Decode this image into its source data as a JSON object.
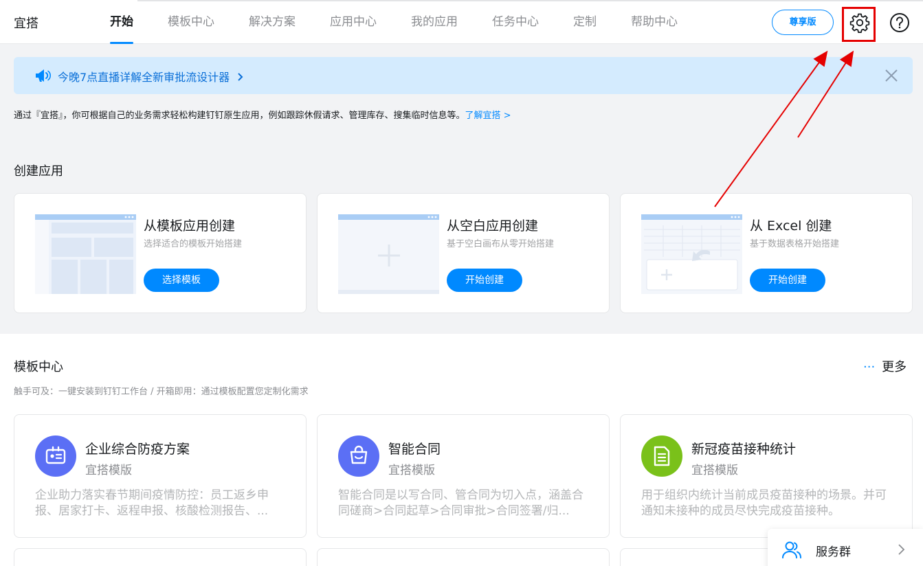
{
  "header": {
    "brand": "宜搭",
    "nav": [
      "开始",
      "模板中心",
      "解决方案",
      "应用中心",
      "我的应用",
      "任务中心",
      "定制",
      "帮助中心"
    ],
    "vip_label": "尊享版"
  },
  "banner": {
    "text": "今晚7点直播详解全新审批流设计器"
  },
  "intro": {
    "text": "通过『宜搭』，你可根据自己的业务需求轻松构建钉钉原生应用，例如跟踪休假请求、管理库存、搜集临时信息等。",
    "link": "了解宜搭 >"
  },
  "create": {
    "title": "创建应用",
    "cards": [
      {
        "title": "从模板应用创建",
        "subtitle": "选择适合的模板开始搭建",
        "button": "选择模板"
      },
      {
        "title": "从空白应用创建",
        "subtitle": "基于空白画布从零开始搭建",
        "button": "开始创建"
      },
      {
        "title": "从 Excel 创建",
        "subtitle": "基于数据表格开始搭建",
        "button": "开始创建"
      }
    ]
  },
  "templates": {
    "title": "模板中心",
    "more": "更多",
    "description": "触手可及：一键安装到钉钉工作台 / 开箱即用：通过模板配置您定制化需求",
    "cards": [
      {
        "name": "企业综合防疫方案",
        "tag": "宜搭模版",
        "text": "企业助力落实春节期间疫情防控：员工返乡申报、居家打卡、返程申报、核酸检测报告、...",
        "color": "#5b6ff5"
      },
      {
        "name": "智能合同",
        "tag": "宜搭模版",
        "text": "智能合同是以写合同、管合同为切入点，涵盖合同磋商>合同起草>合同审批>合同签署/归...",
        "color": "#5b6ff5"
      },
      {
        "name": "新冠疫苗接种统计",
        "tag": "宜搭模版",
        "text": "用于组织内统计当前成员疫苗接种的场景。并可通知未接种的成员尽快完成疫苗接种。",
        "color": "#7ac11a"
      }
    ]
  },
  "service": {
    "label": "服务群"
  },
  "colors": {
    "primary": "#0089ff",
    "highlight": "#e50000"
  }
}
